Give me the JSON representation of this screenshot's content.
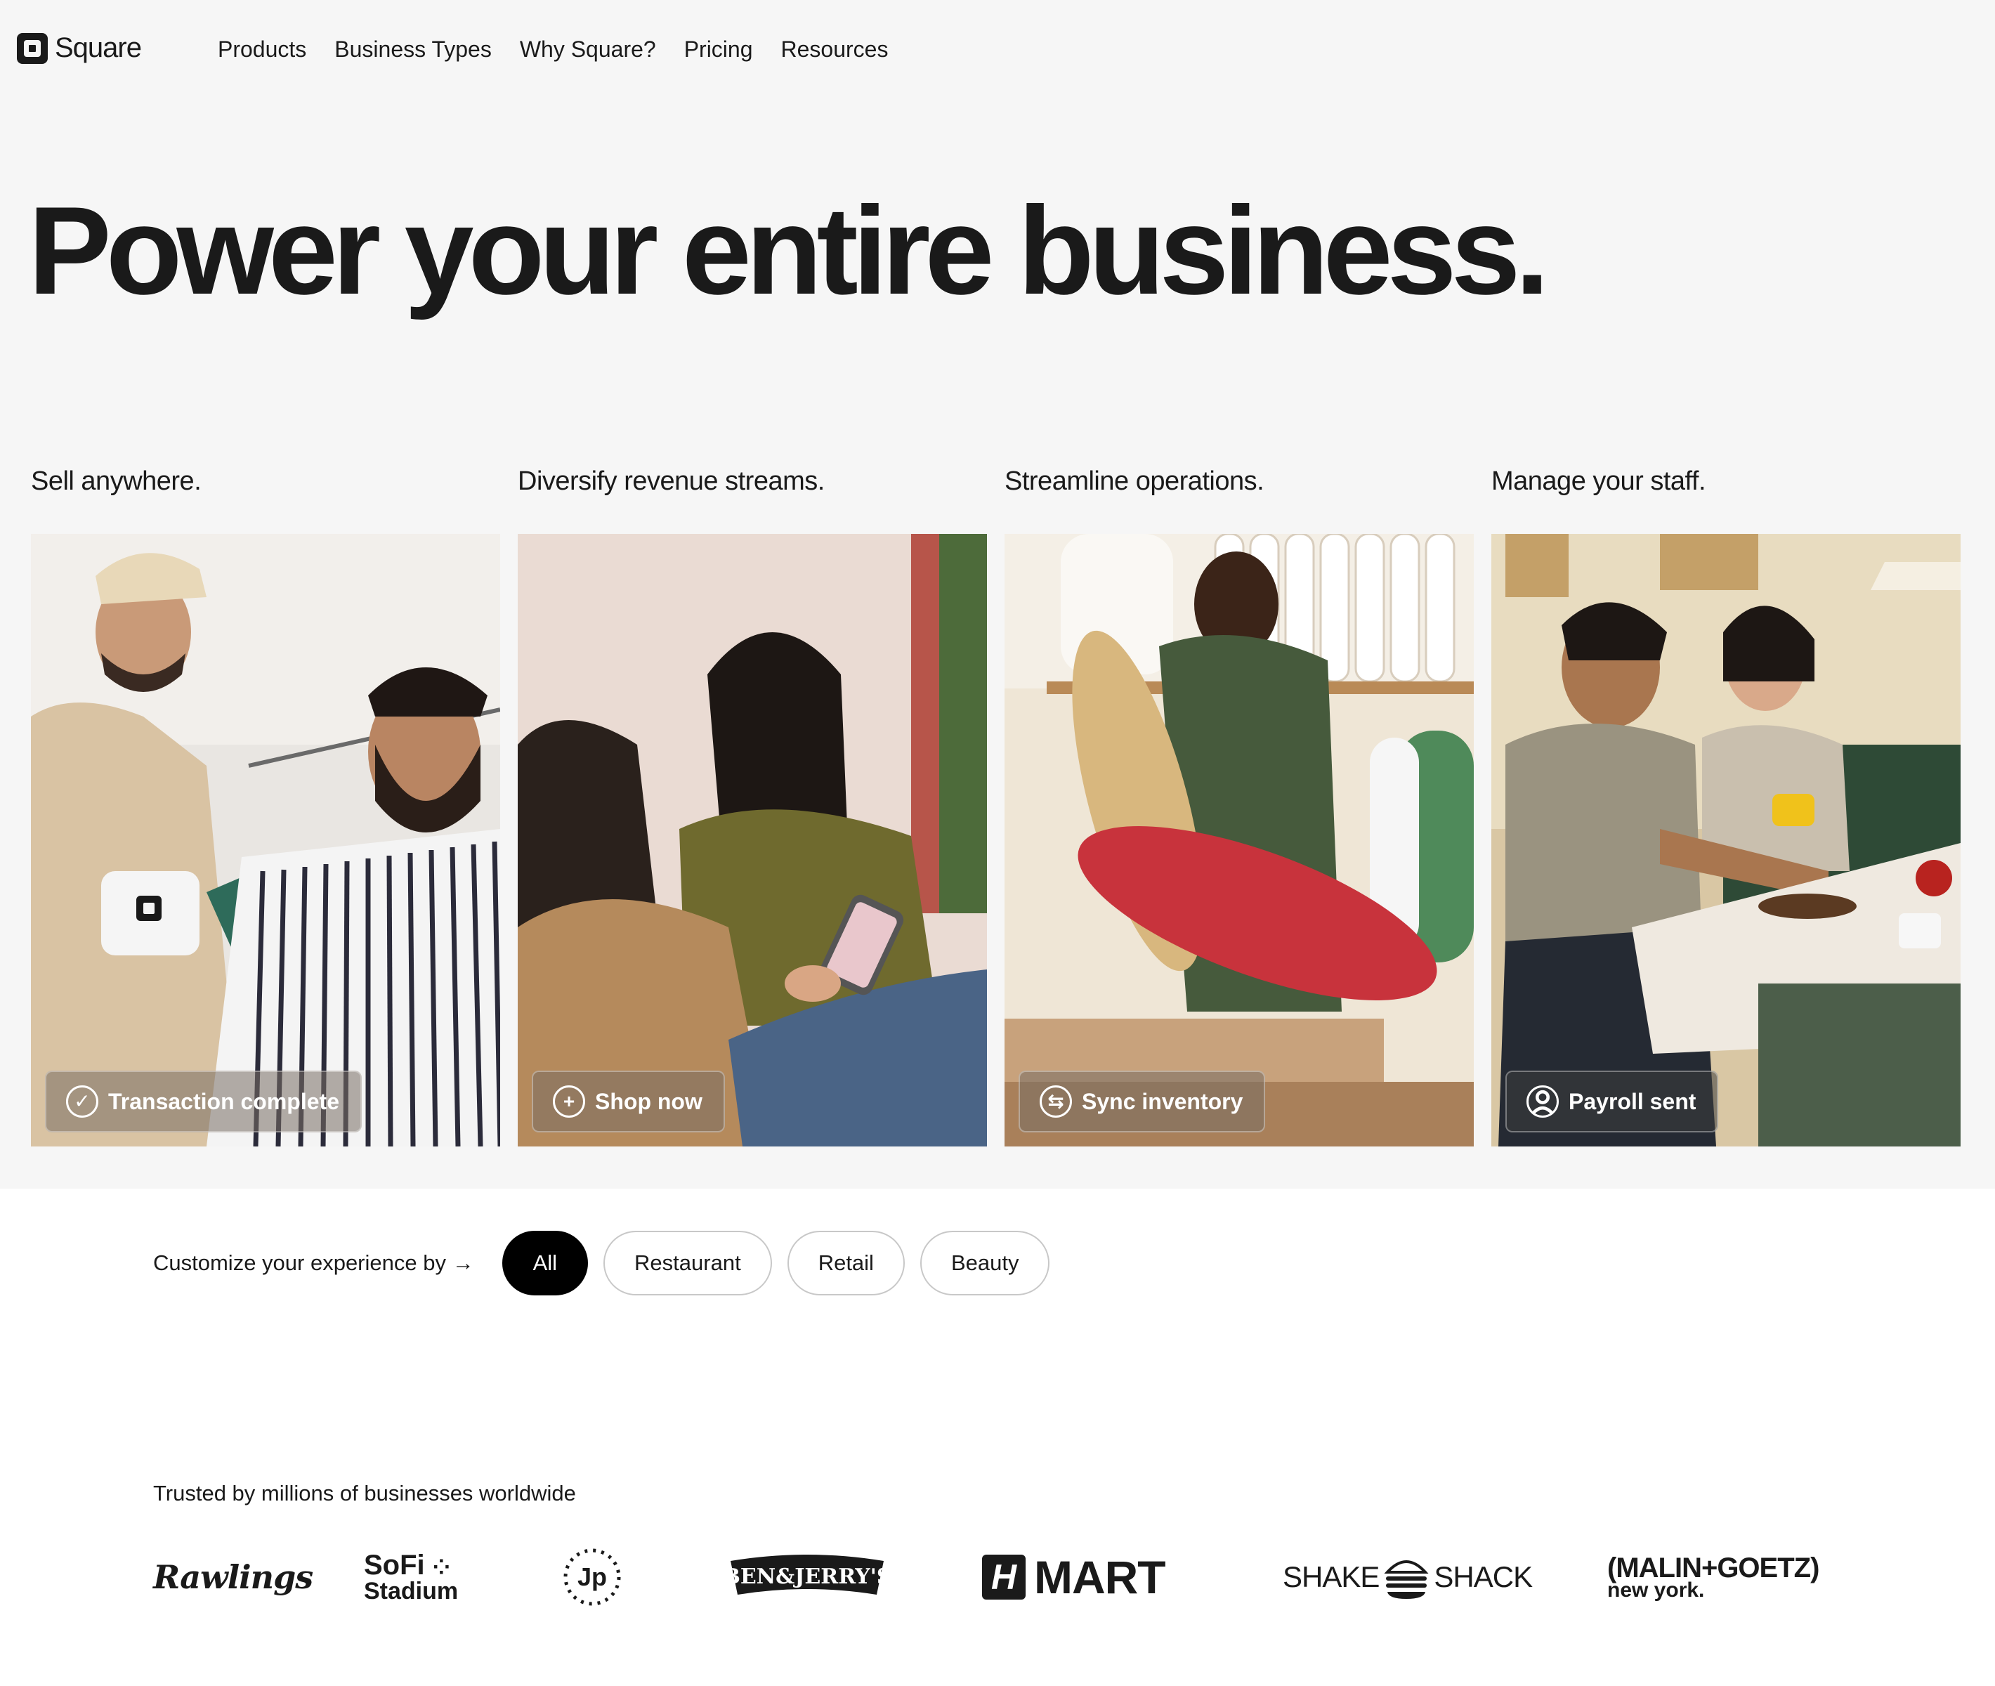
{
  "header": {
    "logo_text": "Square",
    "nav": [
      "Products",
      "Business Types",
      "Why Square?",
      "Pricing",
      "Resources"
    ]
  },
  "hero": {
    "title": "Power your entire business."
  },
  "cards": [
    {
      "title": "Sell anywhere.",
      "action": "Transaction complete",
      "icon": "check-circle-icon"
    },
    {
      "title": "Diversify revenue streams.",
      "action": "Shop now",
      "icon": "plus-circle-icon"
    },
    {
      "title": "Streamline operations.",
      "action": "Sync inventory",
      "icon": "sync-icon"
    },
    {
      "title": "Manage your staff.",
      "action": "Payroll sent",
      "icon": "user-circle-icon"
    }
  ],
  "filter": {
    "label": "Customize your experience by →",
    "options": [
      "All",
      "Restaurant",
      "Retail",
      "Beauty"
    ],
    "selected": "All"
  },
  "trusted": {
    "label": "Trusted by millions of businesses worldwide",
    "brands": [
      "Rawlings",
      "SoFi Stadium",
      "Jp",
      "Ben & Jerry's",
      "H Mart",
      "Shake Shack",
      "(MALIN+GOETZ) new york."
    ]
  }
}
